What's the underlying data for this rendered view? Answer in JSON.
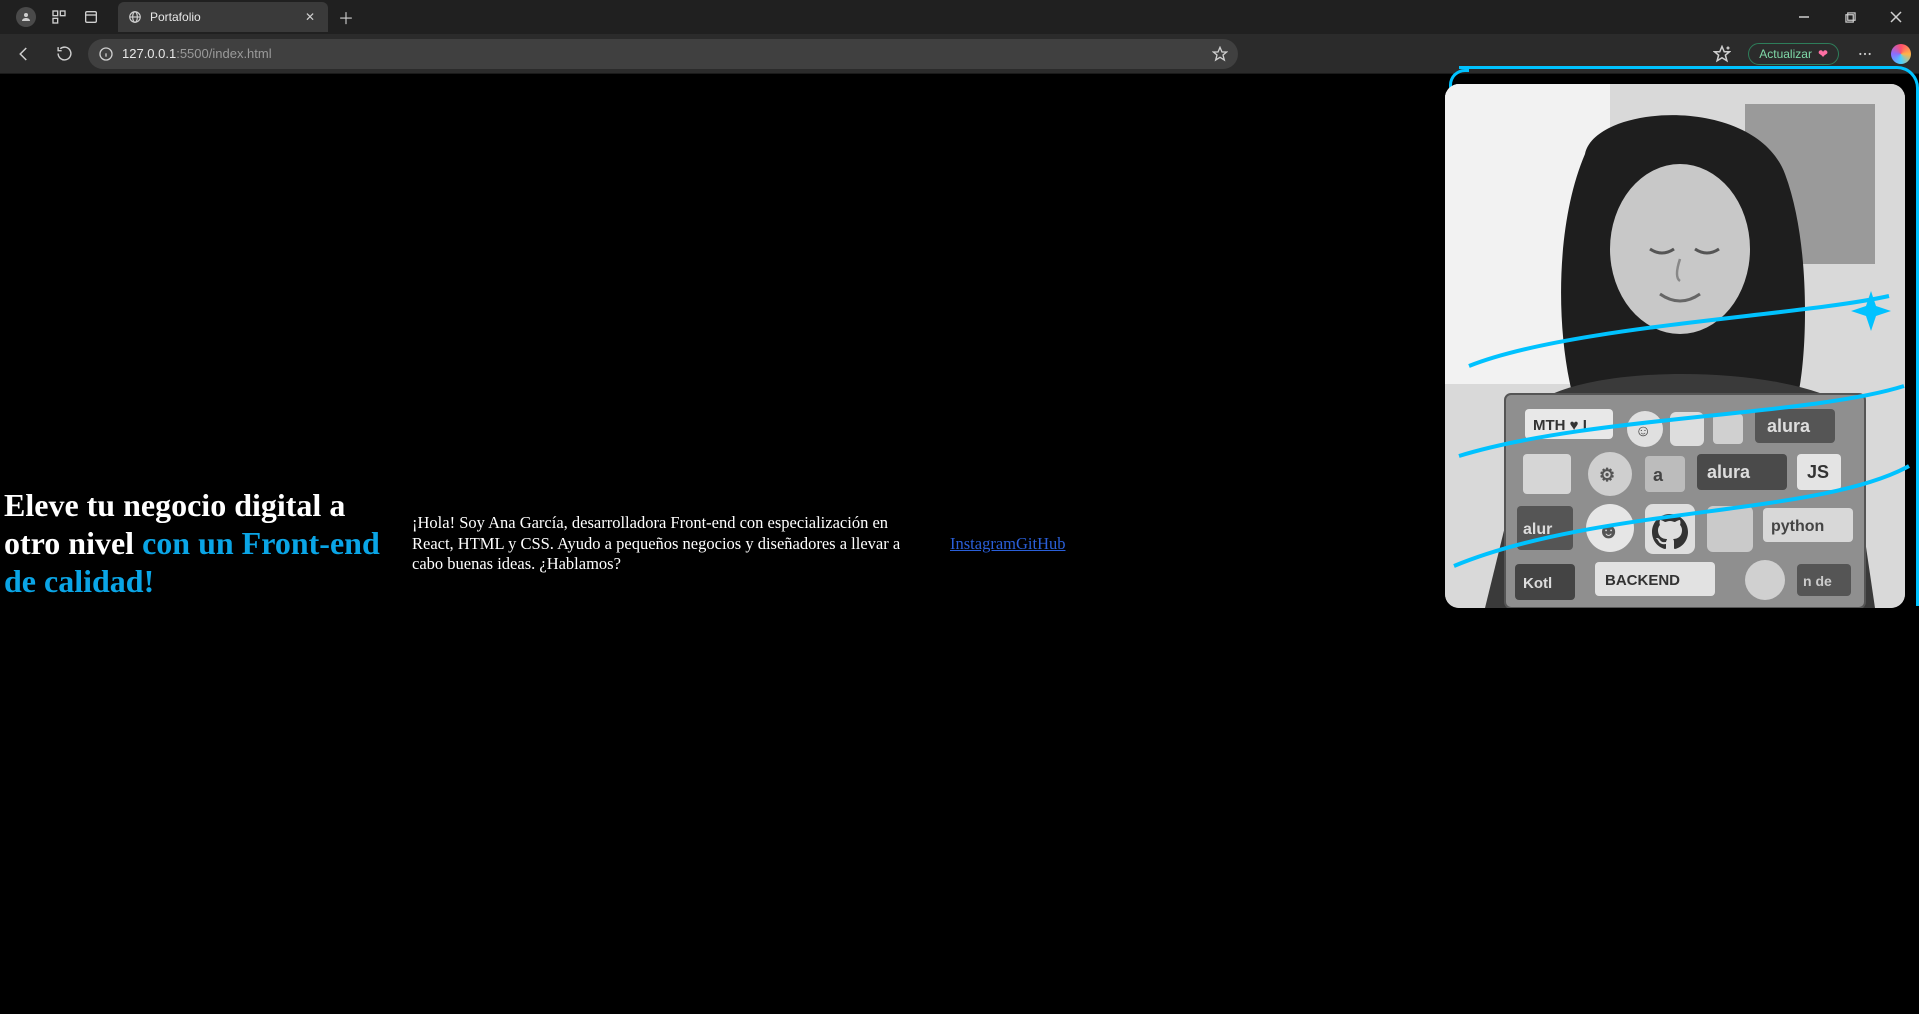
{
  "browser": {
    "tab_title": "Portafolio",
    "url_host": "127.0.0.1",
    "url_port_path": ":5500/index.html",
    "refresh_label": "Actualizar"
  },
  "hero": {
    "headline_plain": "Eleve tu negocio digital a otro nivel ",
    "headline_accent": "con un Front-end de calidad!",
    "description": "¡Hola! Soy Ana García, desarrolladora Front-end con especialización en React, HTML y CSS. Ayudo a pequeños negocios y diseñadores a llevar a cabo buenas ideas. ¿Hablamos?",
    "links": {
      "instagram": "Instagram",
      "github": "GitHub"
    }
  },
  "colors": {
    "accent": "#00c2ff",
    "link": "#2a5fd9"
  }
}
